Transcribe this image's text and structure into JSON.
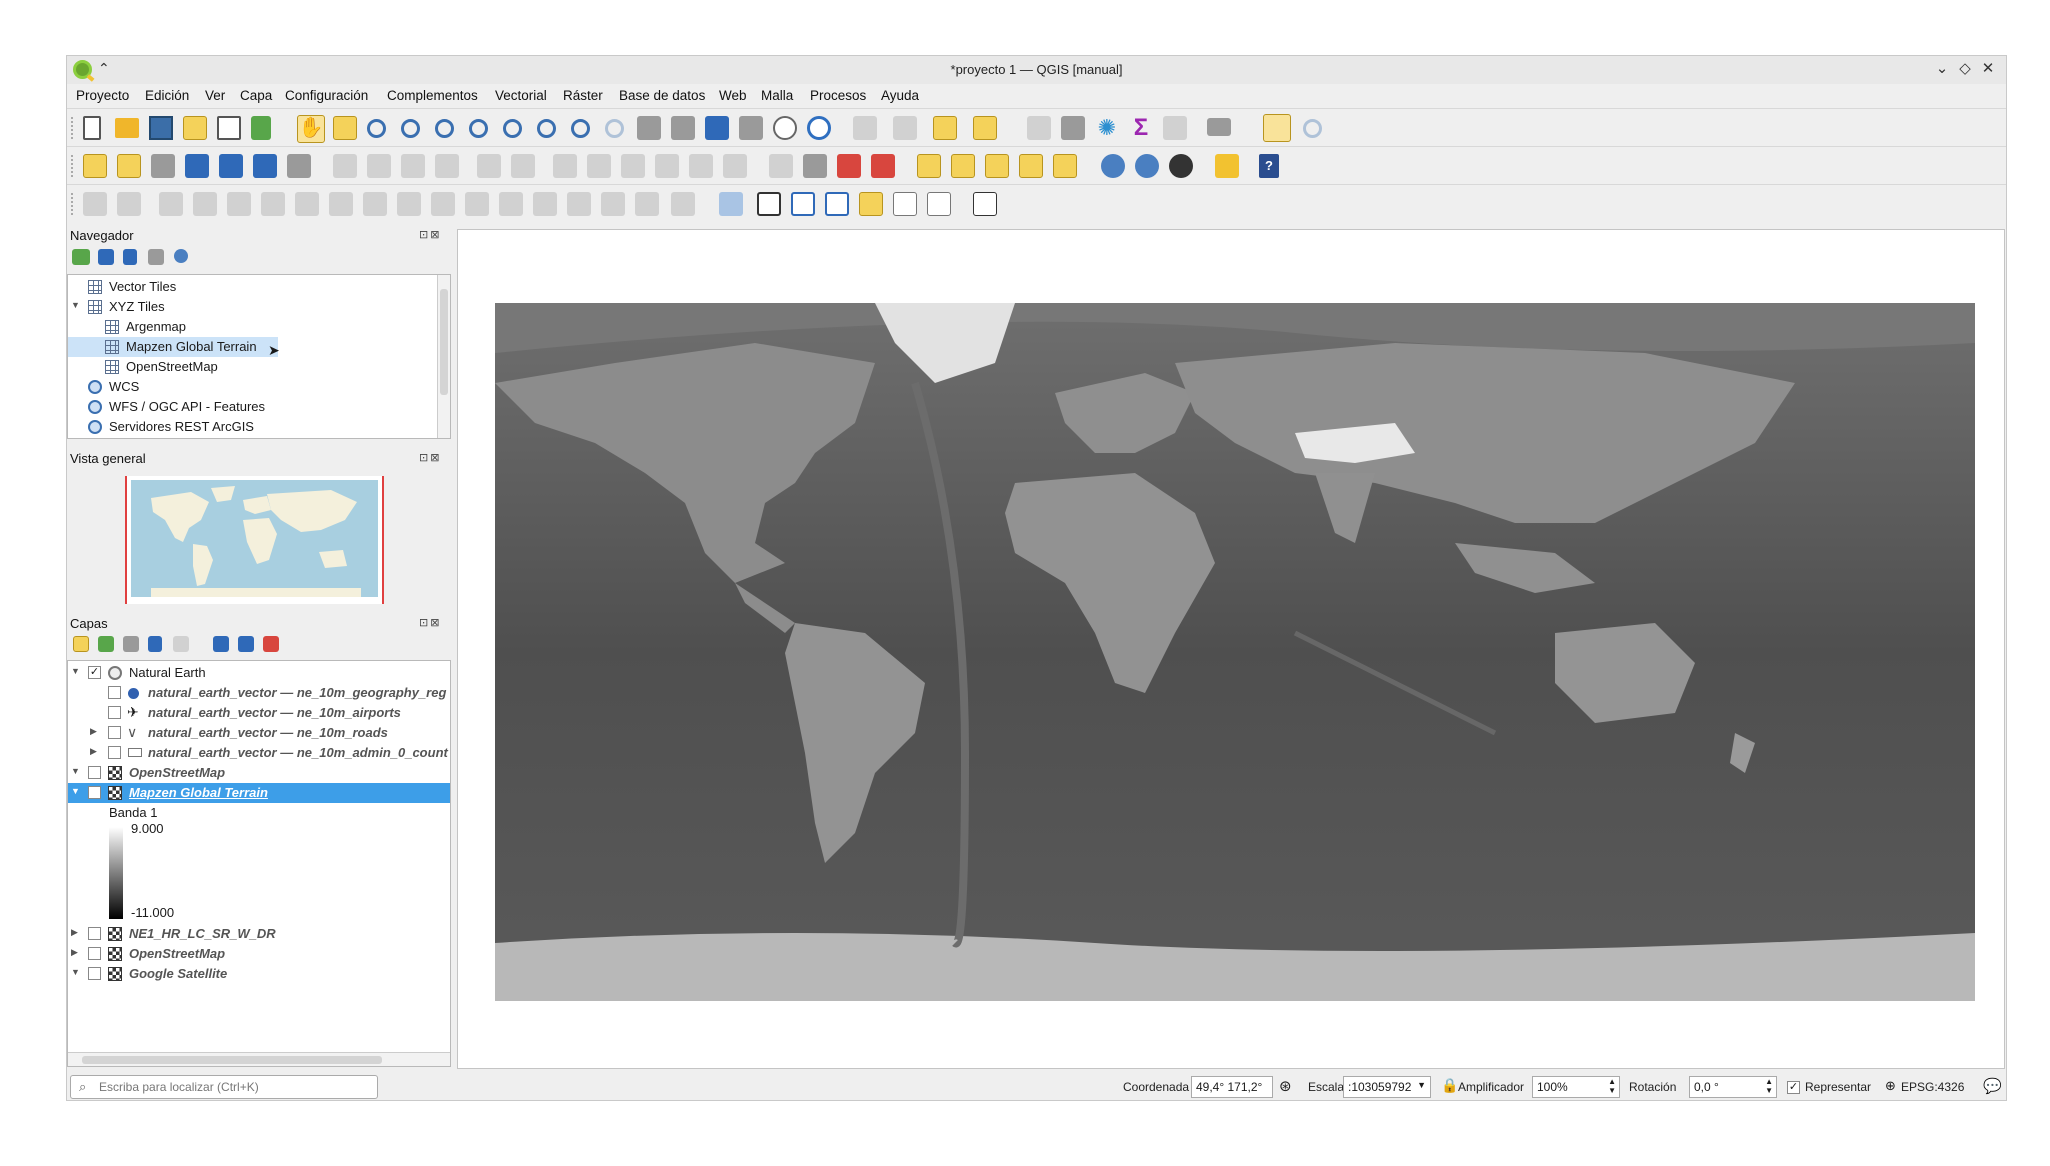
{
  "window": {
    "title": "*proyecto 1 — QGIS [manual]"
  },
  "menu": [
    "Proyecto",
    "Edición",
    "Ver",
    "Capa",
    "Configuración",
    "Complementos",
    "Vectorial",
    "Ráster",
    "Base de datos",
    "Web",
    "Malla",
    "Procesos",
    "Ayuda"
  ],
  "browser": {
    "title": "Navegador",
    "items": [
      {
        "label": "Vector Tiles",
        "icon": "grid-icon"
      },
      {
        "label": "XYZ Tiles",
        "icon": "grid-icon"
      },
      {
        "label": "Argenmap",
        "icon": "grid-icon"
      },
      {
        "label": "Mapzen Global Terrain",
        "icon": "grid-icon"
      },
      {
        "label": "OpenStreetMap",
        "icon": "grid-icon"
      },
      {
        "label": "WCS",
        "icon": "globe-icon"
      },
      {
        "label": "WFS / OGC API - Features",
        "icon": "globe-icon"
      },
      {
        "label": "Servidores REST ArcGIS",
        "icon": "globe-icon"
      }
    ]
  },
  "overview": {
    "title": "Vista general"
  },
  "layers": {
    "title": "Capas",
    "items": [
      {
        "label": "Natural Earth"
      },
      {
        "label": "natural_earth_vector — ne_10m_geography_reg"
      },
      {
        "label": "natural_earth_vector — ne_10m_airports"
      },
      {
        "label": "natural_earth_vector — ne_10m_roads"
      },
      {
        "label": "natural_earth_vector — ne_10m_admin_0_count"
      },
      {
        "label": "OpenStreetMap"
      },
      {
        "label": "Mapzen Global Terrain"
      },
      {
        "label": "NE1_HR_LC_SR_W_DR"
      },
      {
        "label": "OpenStreetMap"
      },
      {
        "label": "Google Satellite"
      }
    ],
    "legend": {
      "band": "Banda 1",
      "max": "9.000",
      "min": "-11.000"
    }
  },
  "locator": {
    "placeholder": "Escriba para localizar (Ctrl+K)"
  },
  "status": {
    "coord_label": "Coordenada",
    "coord_value": "49,4° 171,2°",
    "scale_label": "Escala",
    "scale_value": ":103059792",
    "magnifier_label": "Amplificador",
    "magnifier_value": "100%",
    "rotation_label": "Rotación",
    "rotation_value": "0,0 °",
    "render_label": "Representar",
    "crs": "EPSG:4326"
  }
}
